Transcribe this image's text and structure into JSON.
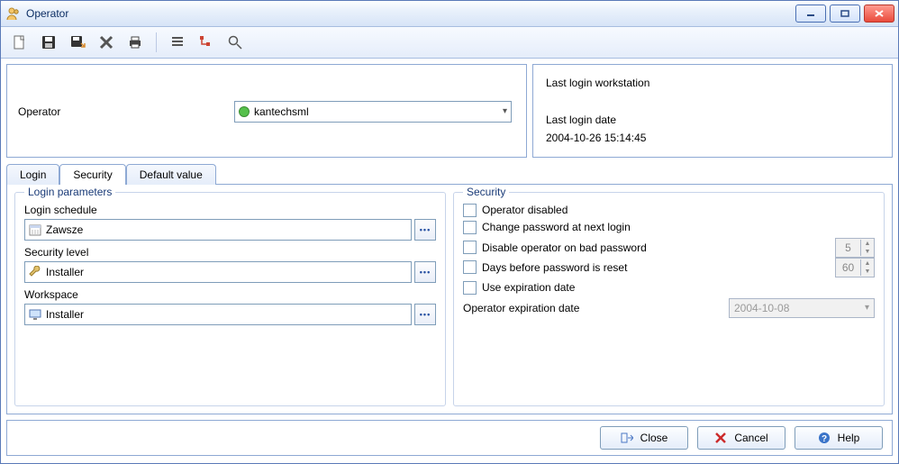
{
  "window": {
    "title": "Operator"
  },
  "header": {
    "operator_label": "Operator",
    "operator_value": "kantechsml",
    "last_workstation_label": "Last login workstation",
    "last_date_label": "Last login date",
    "last_date_value": "2004-10-26 15:14:45"
  },
  "tabs": {
    "login": "Login",
    "security": "Security",
    "default": "Default value"
  },
  "login_params": {
    "legend": "Login parameters",
    "schedule_label": "Login schedule",
    "schedule_value": "Zawsze",
    "security_level_label": "Security level",
    "security_level_value": "Installer",
    "workspace_label": "Workspace",
    "workspace_value": "Installer"
  },
  "security": {
    "legend": "Security",
    "operator_disabled": "Operator disabled",
    "change_pw_next": "Change password at next login",
    "disable_on_bad": "Disable operator on bad password",
    "disable_on_bad_value": "5",
    "days_before_reset": "Days before password is reset",
    "days_before_reset_value": "60",
    "use_expiration": "Use expiration date",
    "expiration_label": "Operator expiration date",
    "expiration_value": "2004-10-08"
  },
  "buttons": {
    "close": "Close",
    "cancel": "Cancel",
    "help": "Help"
  }
}
